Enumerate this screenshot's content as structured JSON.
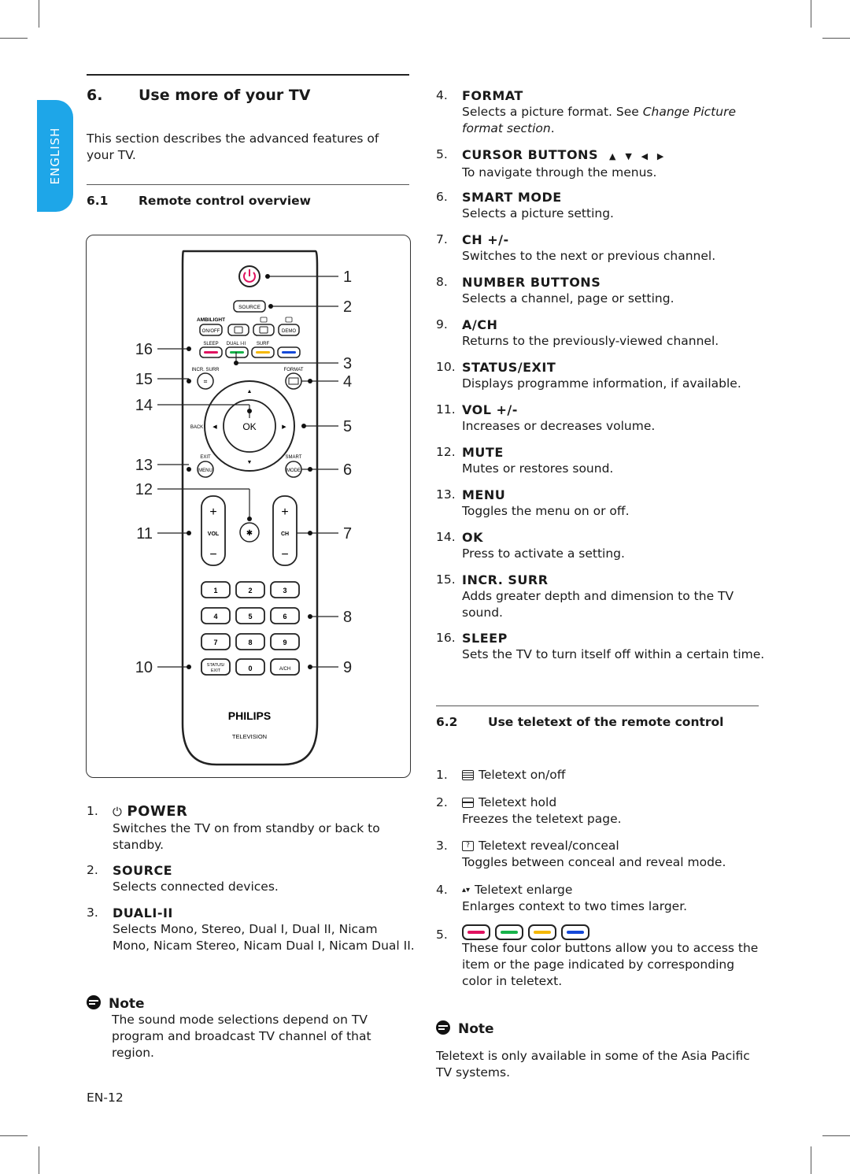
{
  "side_tab": {
    "label": "ENGLISH",
    "color": "#1ea6e8"
  },
  "chapter": {
    "number": "6.",
    "title": "Use more of your TV",
    "intro": "This section describes the advanced features of your TV."
  },
  "section_6_1": {
    "number": "6.1",
    "title": "Remote control overview"
  },
  "remote": {
    "brand": "PHILIPS",
    "sub_brand": "TELEVISION",
    "buttons": {
      "source": "SOURCE",
      "ambilight": "AMBILIGHT",
      "on_off": "ON/OFF",
      "demo": "DEMO",
      "sleep": "SLEEP",
      "dual": "DUAL I-II",
      "surf": "SURF",
      "incr_surr": "INCR. SURR",
      "format": "FORMAT",
      "back": "BACK",
      "ok": "OK",
      "exit": "EXIT",
      "menu": "MENU",
      "smart": "SMART",
      "mode": "MODE",
      "vol": "VOL",
      "ch": "CH",
      "plus": "+",
      "minus": "−",
      "numbers": [
        "1",
        "2",
        "3",
        "4",
        "5",
        "6",
        "7",
        "8",
        "9"
      ],
      "status_exit": "STATUS/ EXIT",
      "zero": "0",
      "a_ch": "A/CH"
    },
    "color_keys": [
      "#e0115f",
      "#17b34a",
      "#f5b800",
      "#1448d8"
    ],
    "callouts_right": [
      "1",
      "2",
      "3",
      "4",
      "5",
      "6",
      "7",
      "8",
      "9"
    ],
    "callouts_left": [
      "16",
      "15",
      "14",
      "13",
      "12",
      "11",
      "10"
    ]
  },
  "left_items": [
    {
      "num": "1.",
      "title": "POWER",
      "icon": "power-icon",
      "desc": "Switches the TV on from standby or back to standby."
    },
    {
      "num": "2.",
      "title": "SOURCE",
      "desc": "Selects connected devices."
    },
    {
      "num": "3.",
      "title": "DUALI-II",
      "desc": "Selects Mono, Stereo, Dual I, Dual II, Nicam Mono, Nicam Stereo, Nicam Dual I, Nicam Dual II."
    }
  ],
  "note_left": {
    "title": "Note",
    "body": "The sound mode selections depend on TV program and broadcast TV channel of that region."
  },
  "page_number": "EN-12",
  "right_items": [
    {
      "num": "4.",
      "title": "FORMAT",
      "desc": "Selects a picture format. See ",
      "desc_italic": "Change Picture format section",
      "desc_end": "."
    },
    {
      "num": "5.",
      "title": "CURSOR BUTTONS",
      "arrows": "▲ ▼ ◀ ▶",
      "desc": "To navigate through the menus."
    },
    {
      "num": "6.",
      "title": "SMART MODE",
      "desc": "Selects a picture setting."
    },
    {
      "num": "7.",
      "title": "CH +/-",
      "desc": "Switches to the next or previous channel."
    },
    {
      "num": "8.",
      "title": "NUMBER BUTTONS",
      "desc": "Selects a channel, page or setting."
    },
    {
      "num": "9.",
      "title": "A/CH",
      "desc": "Returns to the previously-viewed channel."
    },
    {
      "num": "10.",
      "title": "STATUS/EXIT",
      "desc": "Displays programme information, if available."
    },
    {
      "num": "11.",
      "title": "VOL +/-",
      "desc": "Increases or decreases volume."
    },
    {
      "num": "12.",
      "title": "MUTE",
      "desc": "Mutes or restores sound."
    },
    {
      "num": "13.",
      "title": "MENU",
      "desc": "Toggles the menu on or off."
    },
    {
      "num": "14.",
      "title": "OK",
      "desc": "Press to activate a setting."
    },
    {
      "num": "15.",
      "title": "INCR. SURR",
      "desc": "Adds greater depth and dimension to the TV sound."
    },
    {
      "num": "16.",
      "title": "SLEEP",
      "desc": "Sets the TV to turn itself off within a certain time."
    }
  ],
  "section_6_2": {
    "number": "6.2",
    "title": "Use teletext of the remote control"
  },
  "teletext_items": [
    {
      "num": "1.",
      "icon": "teletext-icon",
      "label": "Teletext on/off",
      "desc": ""
    },
    {
      "num": "2.",
      "icon": "teletext-hold-icon",
      "label": "Teletext hold",
      "desc": "Freezes the teletext page."
    },
    {
      "num": "3.",
      "icon": "reveal-icon",
      "label": "Teletext reveal/conceal",
      "desc": "Toggles between conceal and reveal mode."
    },
    {
      "num": "4.",
      "icon": "enlarge-icon",
      "icon_glyph": "▴▾",
      "label": "Teletext enlarge",
      "desc": "Enlarges context to two times larger."
    },
    {
      "num": "5.",
      "icon": "color-buttons",
      "label": "",
      "desc": "These four color buttons allow you to access the item or the page indicated by corresponding color in teletext."
    }
  ],
  "note_right": {
    "title": "Note",
    "body": "Teletext is only available in some of the Asia Pacific TV systems."
  }
}
